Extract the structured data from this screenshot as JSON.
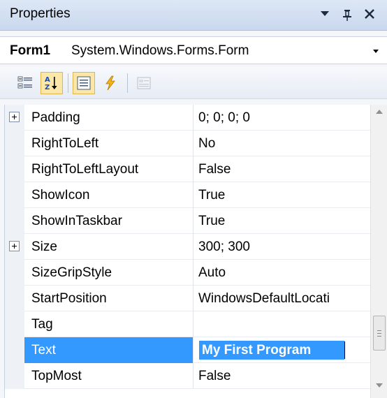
{
  "window": {
    "title": "Properties",
    "pin_glyph": "⨅",
    "close_glyph": "✕"
  },
  "selector": {
    "object_name": "Form1",
    "object_type": "System.Windows.Forms.Form"
  },
  "toolbar": {
    "buttons": [
      {
        "name": "categorized-icon",
        "active": false
      },
      {
        "name": "alphabetical-icon",
        "active": true
      },
      {
        "name": "properties-icon",
        "active": true
      },
      {
        "name": "events-icon",
        "active": false
      },
      {
        "name": "property-pages-icon",
        "active": false
      }
    ]
  },
  "properties": [
    {
      "name": "Padding",
      "value": "0; 0; 0; 0",
      "expandable": true
    },
    {
      "name": "RightToLeft",
      "value": "No",
      "expandable": false
    },
    {
      "name": "RightToLeftLayout",
      "value": "False",
      "expandable": false
    },
    {
      "name": "ShowIcon",
      "value": "True",
      "expandable": false
    },
    {
      "name": "ShowInTaskbar",
      "value": "True",
      "expandable": false
    },
    {
      "name": "Size",
      "value": "300; 300",
      "expandable": true
    },
    {
      "name": "SizeGripStyle",
      "value": "Auto",
      "expandable": false
    },
    {
      "name": "StartPosition",
      "value": "WindowsDefaultLocati",
      "expandable": false
    },
    {
      "name": "Tag",
      "value": "",
      "expandable": false
    },
    {
      "name": "Text",
      "value": "My First Program",
      "expandable": false,
      "selected": true
    },
    {
      "name": "TopMost",
      "value": "False",
      "expandable": false
    }
  ],
  "colors": {
    "selection": "#3399ff",
    "active_button": "#fbe7a7"
  }
}
